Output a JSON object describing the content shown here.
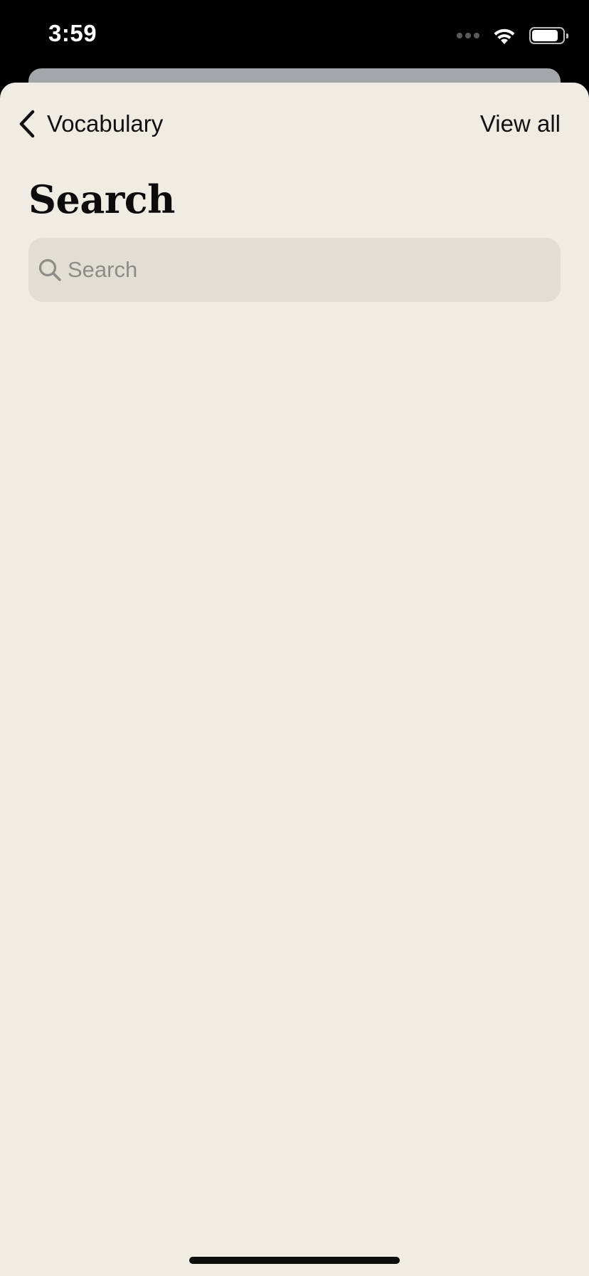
{
  "status_bar": {
    "time": "3:59",
    "icons": [
      "signal-dots-icon",
      "wifi-icon",
      "battery-icon"
    ],
    "text_color": "#ffffff"
  },
  "nav": {
    "back_label": "Vocabulary",
    "back_icon": "chevron-left-icon",
    "right_action_label": "View all"
  },
  "page": {
    "title": "Search"
  },
  "search": {
    "placeholder": "Search",
    "value": "",
    "icon": "search-icon"
  },
  "colors": {
    "sheet_background": "#efece4",
    "search_field_background": "#e1ded6",
    "underlay_card": "#a4a7aa",
    "placeholder_text": "#8e8c87",
    "primary_text": "#111111"
  }
}
